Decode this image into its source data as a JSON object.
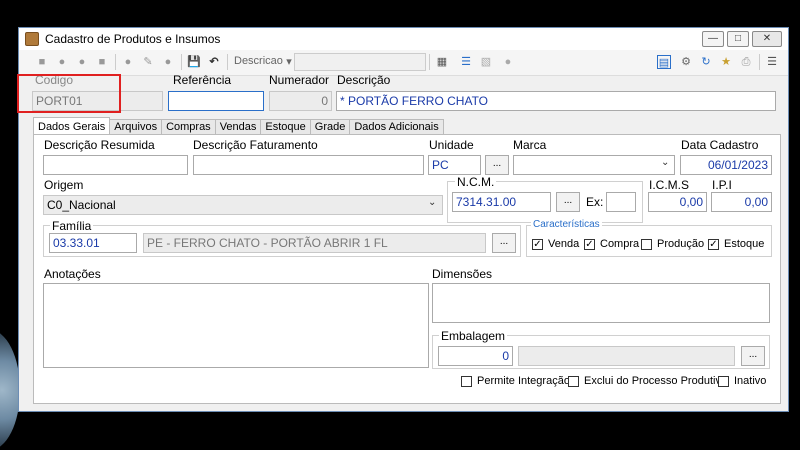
{
  "window": {
    "title": "Cadastro de Produtos e Insumos"
  },
  "toolbar": {
    "combo_label": "Descricao",
    "combo_value": ""
  },
  "header": {
    "codigo_label": "Codigo",
    "codigo_value": "PORT01",
    "referencia_label": "Referência",
    "referencia_value": "",
    "numerador_label": "Numerador",
    "numerador_value": "0",
    "descricao_label": "Descrição",
    "descricao_value": "* PORTÃO FERRO CHATO"
  },
  "tabs": [
    "Dados Gerais",
    "Arquivos",
    "Compras",
    "Vendas",
    "Estoque",
    "Grade",
    "Dados Adicionais"
  ],
  "form": {
    "desc_resumida_label": "Descrição Resumida",
    "desc_resumida_value": "",
    "desc_faturamento_label": "Descrição Faturamento",
    "desc_faturamento_value": "",
    "unidade_label": "Unidade",
    "unidade_value": "PC",
    "marca_label": "Marca",
    "marca_value": "",
    "data_cadastro_label": "Data Cadastro",
    "data_cadastro_value": "06/01/2023",
    "origem_label": "Origem",
    "origem_value": "C0_Nacional",
    "ncm_label": "N.C.M.",
    "ncm_value": "7314.31.00",
    "ex_label": "Ex:",
    "ex_value": "",
    "icms_label": "I.C.M.S",
    "icms_value": "0,00",
    "ipi_label": "I.P.I",
    "ipi_value": "0,00",
    "familia_label": "Família",
    "familia_code": "03.33.01",
    "familia_desc": "PE - FERRO CHATO - PORTÃO ABRIR 1 FL",
    "caracteristicas_label": "Características",
    "caracteristicas": [
      {
        "label": "Venda",
        "checked": "✓"
      },
      {
        "label": "Compra",
        "checked": "✓"
      },
      {
        "label": "Produção",
        "checked": ""
      },
      {
        "label": "Estoque",
        "checked": "✓"
      }
    ],
    "anotacoes_label": "Anotações",
    "dimensoes_label": "Dimensões",
    "embalagem_label": "Embalagem",
    "embalagem_value": "0",
    "dots": "...",
    "bottom_checks": [
      {
        "label": "Permite Integração",
        "checked": ""
      },
      {
        "label": "Exclui do Processo Produtivo",
        "checked": ""
      },
      {
        "label": "Inativo",
        "checked": ""
      }
    ]
  }
}
